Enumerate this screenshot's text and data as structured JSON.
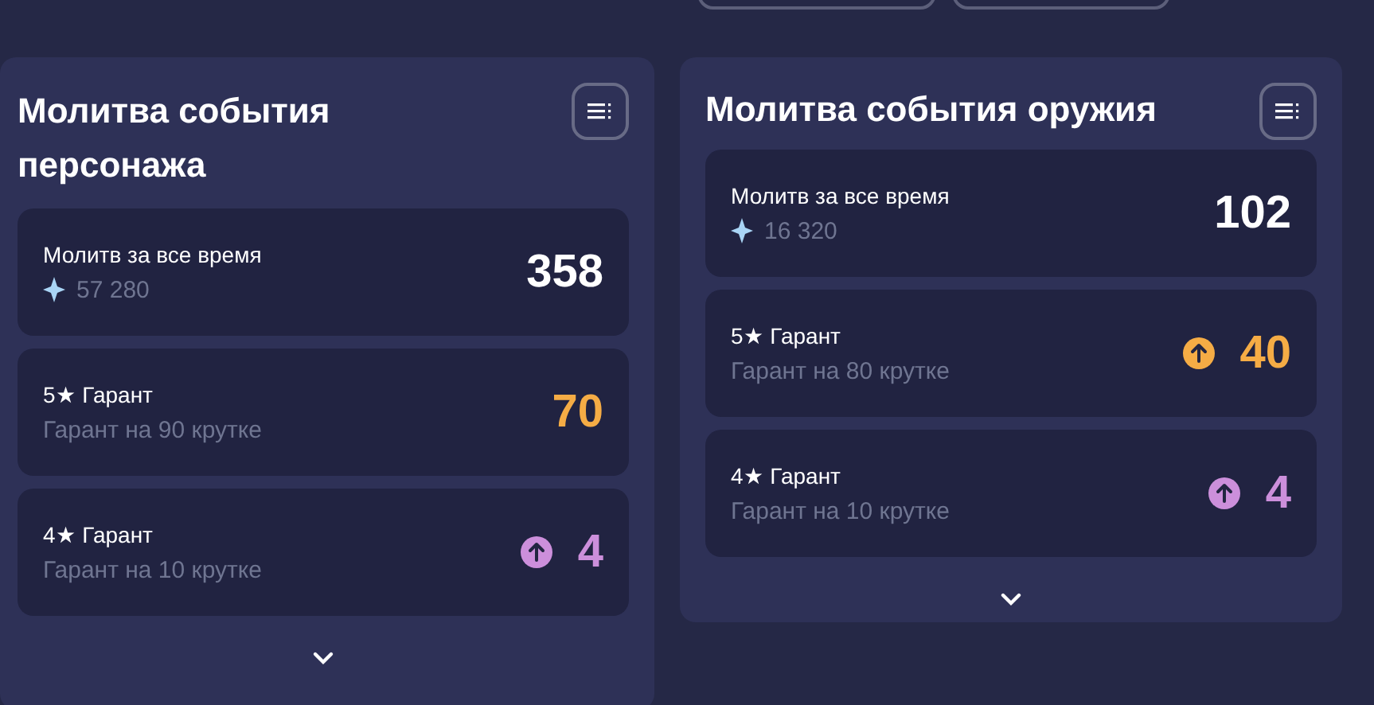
{
  "top_buttons": [
    {
      "kind": "outline"
    },
    {
      "kind": "outline"
    }
  ],
  "panels": [
    {
      "title": "Молитва события персонажа",
      "rows": [
        {
          "kind": "total",
          "label": "Молитв за все время",
          "amount": "57 280",
          "value": "358",
          "boosted": false
        },
        {
          "kind": "five_star",
          "label": "5★ Гарант",
          "note": "Гарант на 90 крутке",
          "value": "70",
          "boosted": false
        },
        {
          "kind": "four_star",
          "label": "4★ Гарант",
          "note": "Гарант на 10 крутке",
          "value": "4",
          "boosted": true
        }
      ]
    },
    {
      "title": "Молитва события оружия",
      "rows": [
        {
          "kind": "total",
          "label": "Молитв за все время",
          "amount": "16 320",
          "value": "102",
          "boosted": false
        },
        {
          "kind": "five_star",
          "label": "5★ Гарант",
          "note": "Гарант на 80 крутке",
          "value": "40",
          "boosted": true
        },
        {
          "kind": "four_star",
          "label": "4★ Гарант",
          "note": "Гарант на 10 крутке",
          "value": "4",
          "boosted": true
        }
      ]
    }
  ]
}
